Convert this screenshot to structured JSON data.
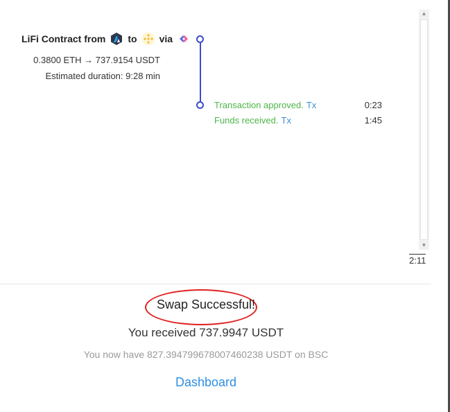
{
  "step": {
    "title_prefix": "LiFi Contract from",
    "to_word": "to",
    "via_word": "via",
    "from_chain_icon": "arbitrum-logo-icon",
    "to_chain_icon": "bnb-chain-logo-icon",
    "via_icon": "lifi-bridge-logo-icon",
    "amount": "0.3800 ETH → 737.9154 USDT",
    "duration": "Estimated duration: 9:28 min",
    "events": [
      {
        "text": "Transaction approved.",
        "link": "Tx",
        "time": "0:23"
      },
      {
        "text": "Funds received.",
        "link": "Tx",
        "time": "1:45"
      }
    ],
    "total_time": "2:11"
  },
  "result": {
    "title": "Swap Successful!",
    "received": "You received 737.9947 USDT",
    "balance": "You now have 827.394799678007460238 USDT on BSC",
    "dashboard_label": "Dashboard"
  },
  "colors": {
    "timeline": "#3b4bc8",
    "event_text": "#4cb648",
    "link": "#3b8fd6",
    "annotation_ring": "#e02020"
  }
}
